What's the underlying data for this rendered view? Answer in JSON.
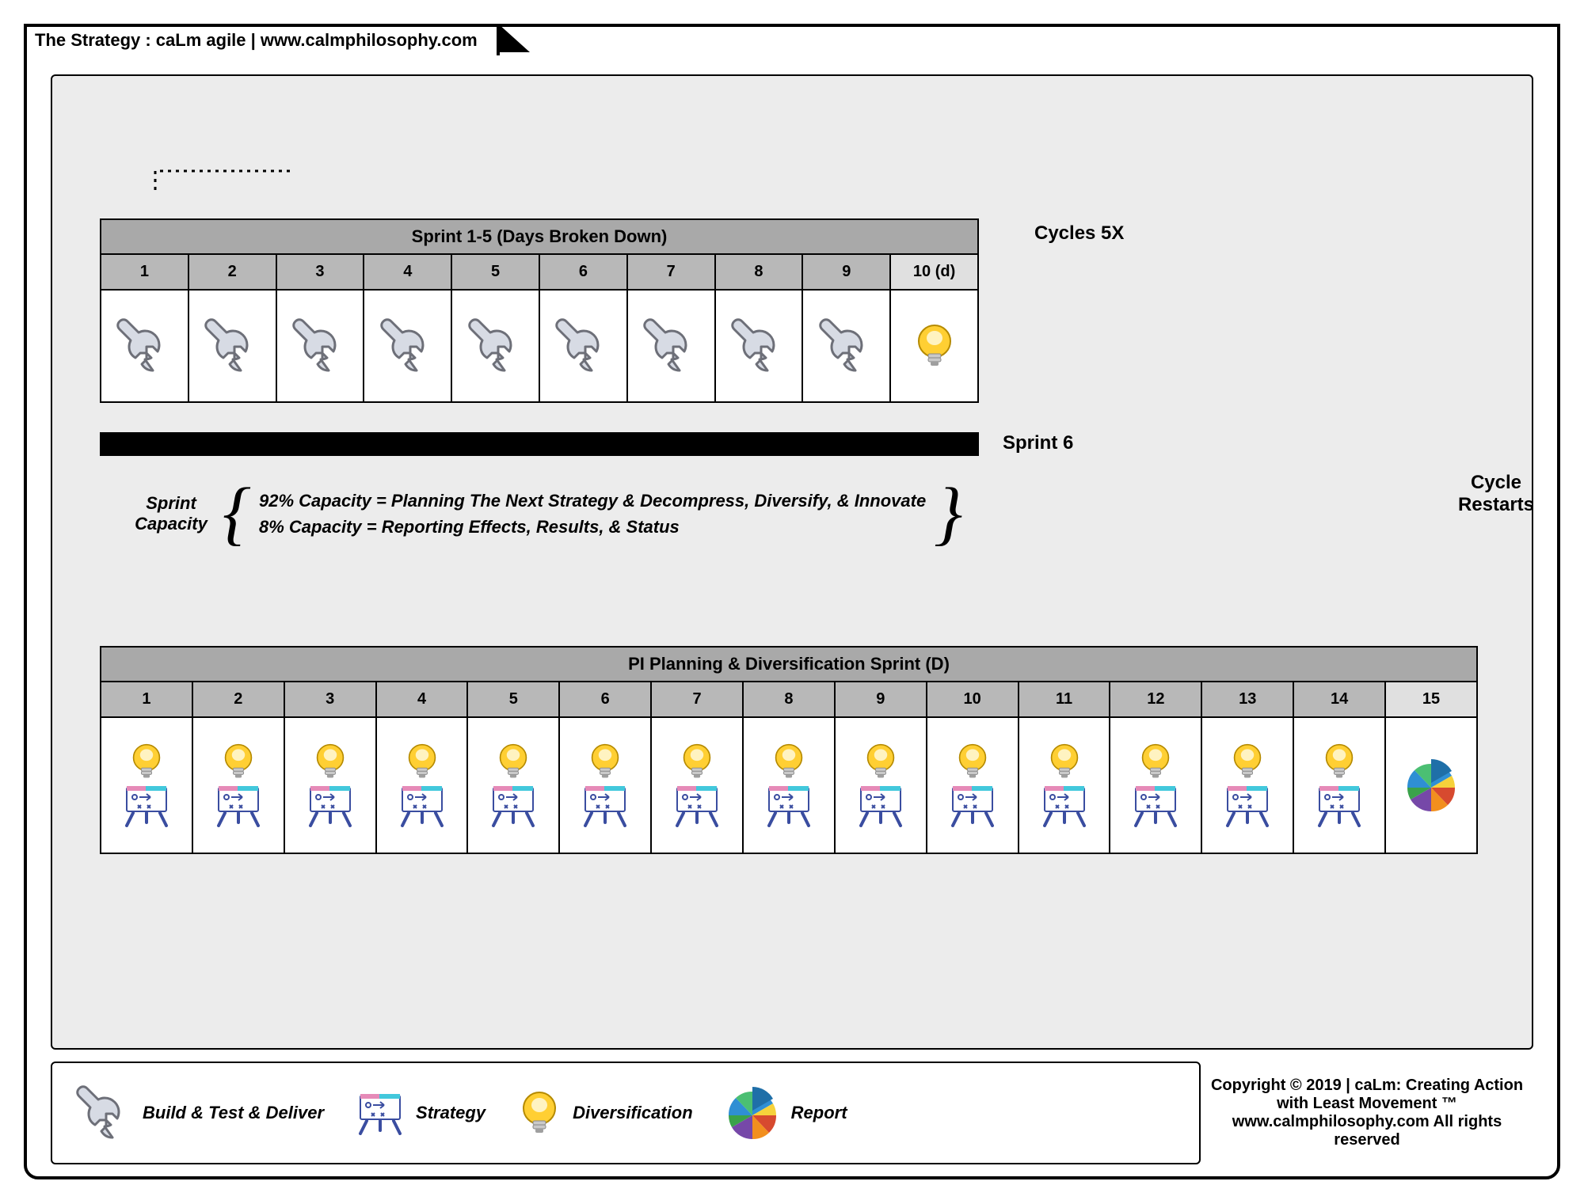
{
  "header": {
    "tab_title": "The Strategy :  caLm agile | www.calmphilosophy.com"
  },
  "sprint_top": {
    "title": "Sprint 1-5 (Days Broken Down)",
    "cols": [
      "1",
      "2",
      "3",
      "4",
      "5",
      "6",
      "7",
      "8",
      "9",
      "10 (d)"
    ],
    "icons": [
      "wrench",
      "wrench",
      "wrench",
      "wrench",
      "wrench",
      "wrench",
      "wrench",
      "wrench",
      "wrench",
      "bulb"
    ]
  },
  "labels": {
    "cycles5x": "Cycles 5X",
    "sprint6": "Sprint 6",
    "cycle_restarts": "Cycle Restarts"
  },
  "capacity": {
    "label_line1": "Sprint",
    "label_line2": "Capacity",
    "line1": "92% Capacity = Planning The Next Strategy & Decompress, Diversify, & Innovate",
    "line2": "8% Capacity = Reporting Effects, Results, & Status"
  },
  "sprint_bottom": {
    "title": "PI Planning & Diversification Sprint (D)",
    "cols": [
      "1",
      "2",
      "3",
      "4",
      "5",
      "6",
      "7",
      "8",
      "9",
      "10",
      "11",
      "12",
      "13",
      "14",
      "15"
    ],
    "icons": [
      "bulb_easel",
      "bulb_easel",
      "bulb_easel",
      "bulb_easel",
      "bulb_easel",
      "bulb_easel",
      "bulb_easel",
      "bulb_easel",
      "bulb_easel",
      "bulb_easel",
      "bulb_easel",
      "bulb_easel",
      "bulb_easel",
      "bulb_easel",
      "pie"
    ]
  },
  "legend": {
    "items": [
      {
        "icon": "wrench",
        "label": "Build & Test & Deliver"
      },
      {
        "icon": "easel",
        "label": "Strategy"
      },
      {
        "icon": "bulb",
        "label": "Diversification"
      },
      {
        "icon": "pie",
        "label": "Report"
      }
    ]
  },
  "copyright": "Copyright © 2019 | caLm: Creating Action with Least Movement ™ www.calmphilosophy.com All rights reserved"
}
